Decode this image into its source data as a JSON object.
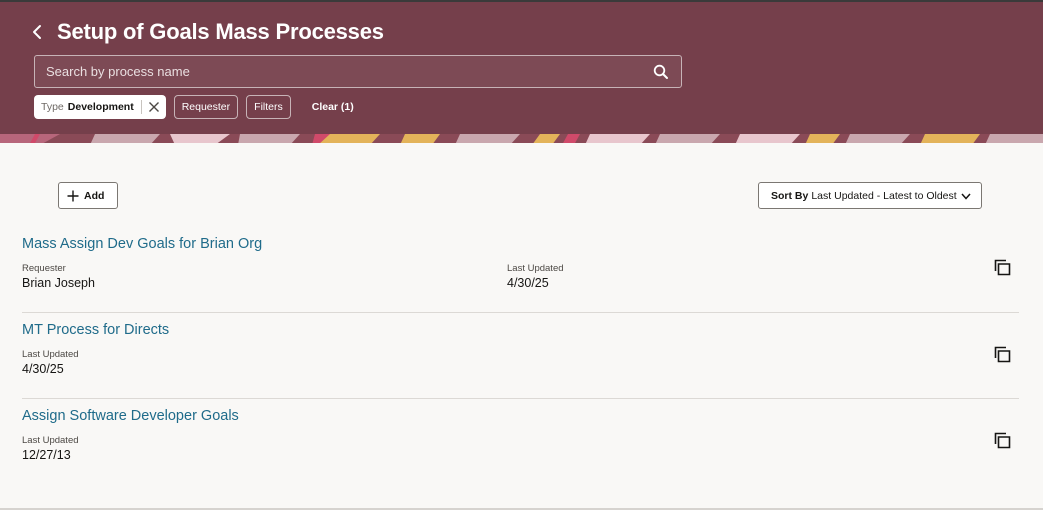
{
  "header": {
    "title": "Setup of Goals Mass Processes",
    "colors": {
      "banner": "#753f4b",
      "link": "#1f6b8a"
    }
  },
  "search": {
    "placeholder": "Search by process name",
    "value": ""
  },
  "filters": {
    "type_chip": {
      "label": "Type",
      "value": "Development"
    },
    "requester_label": "Requester",
    "filters_label": "Filters",
    "clear_label": "Clear (1)"
  },
  "toolbar": {
    "add_label": "Add",
    "sort_label": "Sort By",
    "sort_value": "Last Updated - Latest to Oldest"
  },
  "processes": [
    {
      "name": "Mass Assign Dev Goals for Brian Org",
      "requester_label": "Requester",
      "requester": "Brian Joseph",
      "updated_label": "Last Updated",
      "updated": "4/30/25"
    },
    {
      "name": "MT Process for Directs",
      "updated_label": "Last Updated",
      "updated": "4/30/25"
    },
    {
      "name": "Assign Software Developer Goals",
      "updated_label": "Last Updated",
      "updated": "12/27/13"
    }
  ],
  "icons": {
    "back": "chevron-left-icon",
    "search": "search-icon",
    "clear_chip": "close-icon",
    "add": "plus-icon",
    "sort": "chevron-down-icon",
    "copy": "duplicate-icon"
  }
}
